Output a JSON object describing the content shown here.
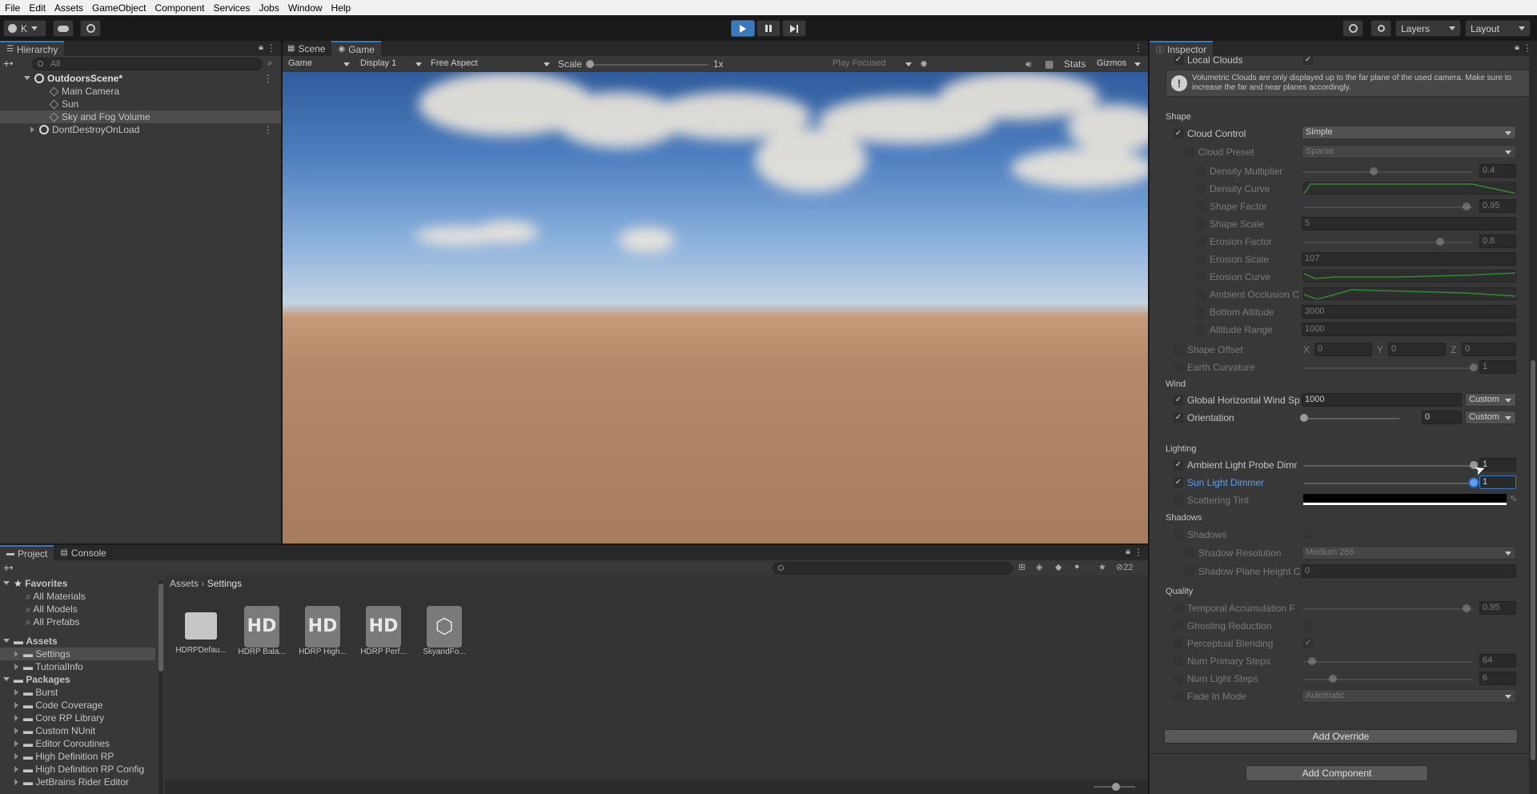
{
  "menu": [
    "File",
    "Edit",
    "Assets",
    "GameObject",
    "Component",
    "Services",
    "Jobs",
    "Window",
    "Help"
  ],
  "toolbar": {
    "account": "K",
    "layers": "Layers",
    "layout": "Layout"
  },
  "hierarchy": {
    "tab": "Hierarchy",
    "search_placeholder": "All",
    "items": [
      "OutdoorsScene*",
      "Main Camera",
      "Sun",
      "Sky and Fog Volume",
      "DontDestroyOnLoad"
    ]
  },
  "view_tabs": {
    "scene": "Scene",
    "game": "Game"
  },
  "game_bar": {
    "mode": "Game",
    "display": "Display 1",
    "aspect": "Free Aspect",
    "scale_label": "Scale",
    "scale_value": "1x",
    "play_focused": "Play Focused",
    "stats": "Stats",
    "gizmos": "Gizmos"
  },
  "project": {
    "tab_project": "Project",
    "tab_console": "Console",
    "hidden_count": "22",
    "favorites": {
      "title": "Favorites",
      "items": [
        "All Materials",
        "All Models",
        "All Prefabs"
      ]
    },
    "assets": {
      "title": "Assets",
      "items": [
        "Settings",
        "TutorialInfo"
      ]
    },
    "packages": {
      "title": "Packages",
      "items": [
        "Burst",
        "Code Coverage",
        "Core RP Library",
        "Custom NUnit",
        "Editor Coroutines",
        "High Definition RP",
        "High Definition RP Config",
        "JetBrains Rider Editor"
      ]
    },
    "breadcrumb": [
      "Assets",
      "Settings"
    ],
    "files": [
      "HDRPDefau...",
      "HDRP Bala...",
      "HDRP High...",
      "HDRP Perf...",
      "SkyandFo..."
    ],
    "hd_text": "HD"
  },
  "inspector": {
    "tab": "Inspector",
    "local_clouds": "Local Clouds",
    "help": "Volumetric Clouds are only displayed up to the far plane of the used camera. Make sure to increase the far and near planes accordingly.",
    "shape": {
      "title": "Shape",
      "cloud_control": {
        "label": "Cloud Control",
        "value": "Simple"
      },
      "cloud_preset": {
        "label": "Cloud Preset",
        "value": "Sparse"
      },
      "density_multiplier": {
        "label": "Density Multiplier",
        "value": "0.4"
      },
      "density_curve": "Density Curve",
      "shape_factor": {
        "label": "Shape Factor",
        "value": "0.95"
      },
      "shape_scale": {
        "label": "Shape Scale",
        "value": "5"
      },
      "erosion_factor": {
        "label": "Erosion Factor",
        "value": "0.8"
      },
      "erosion_scale": {
        "label": "Erosion Scale",
        "value": "107"
      },
      "erosion_curve": "Erosion Curve",
      "ambient_occlusion": "Ambient Occlusion C",
      "bottom_altitude": {
        "label": "Bottom Altitude",
        "value": "3000"
      },
      "altitude_range": {
        "label": "Altitude Range",
        "value": "1000"
      },
      "shape_offset": {
        "label": "Shape Offset",
        "x": "0",
        "y": "0",
        "z": "0"
      },
      "earth_curvature": {
        "label": "Earth Curvature",
        "value": "1"
      }
    },
    "wind": {
      "title": "Wind",
      "global_speed": {
        "label": "Global Horizontal Wind Sp",
        "value": "1000",
        "mode": "Custom"
      },
      "orientation": {
        "label": "Orientation",
        "value": "0",
        "mode": "Custom"
      }
    },
    "lighting": {
      "title": "Lighting",
      "ambient_dimmer": {
        "label": "Ambient Light Probe Dimr",
        "value": "1"
      },
      "sun_dimmer": {
        "label": "Sun Light Dimmer",
        "value": "1"
      },
      "scattering_tint": "Scattering Tint"
    },
    "shadows": {
      "title": "Shadows",
      "shadows": "Shadows",
      "resolution": {
        "label": "Shadow Resolution",
        "value": "Medium 256"
      },
      "plane_height": {
        "label": "Shadow Plane Height C",
        "value": "0"
      }
    },
    "quality": {
      "title": "Quality",
      "temporal": {
        "label": "Temporal Accumulation F",
        "value": "0.95"
      },
      "ghosting": "Ghosting Reduction",
      "perceptual": "Perceptual Blending",
      "primary_steps": {
        "label": "Num Primary Steps",
        "value": "64"
      },
      "light_steps": {
        "label": "Num Light Steps",
        "value": "6"
      },
      "fade_in": {
        "label": "Fade In Mode",
        "value": "Automatic"
      }
    },
    "add_override": "Add Override",
    "add_component": "Add Component",
    "axis": {
      "x": "X",
      "y": "Y",
      "z": "Z"
    }
  },
  "colors": {
    "accent": "#3a79bb",
    "panel": "#383838",
    "dark": "#191919"
  }
}
